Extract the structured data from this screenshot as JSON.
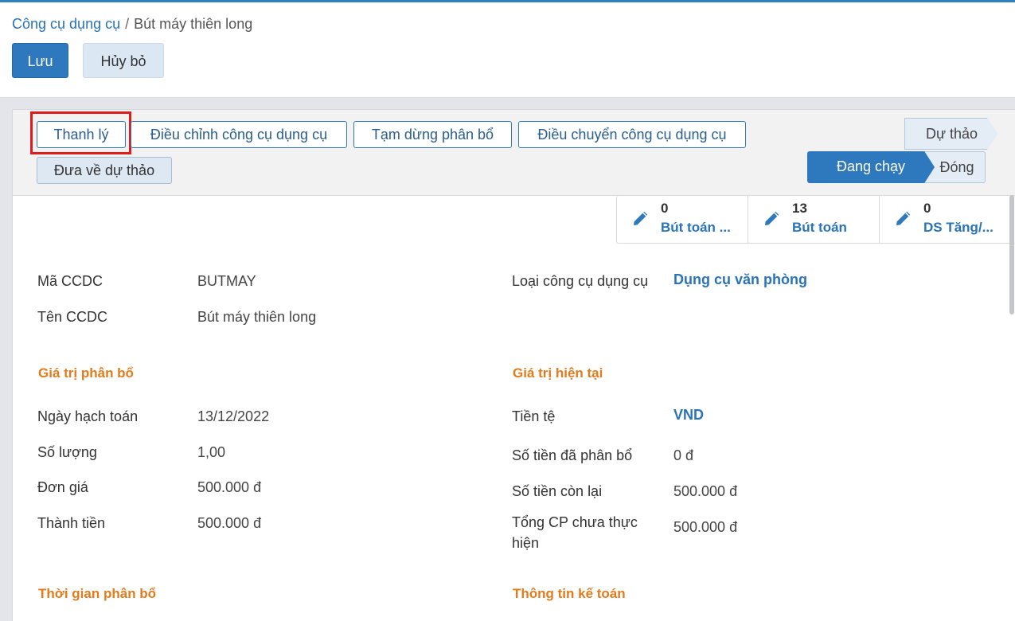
{
  "breadcrumb": {
    "parent": "Công cụ dụng cụ",
    "separator": "/",
    "current": "Bút máy thiên long"
  },
  "toolbar": {
    "save_label": "Lưu",
    "cancel_label": "Hủy bỏ"
  },
  "actions": {
    "liquidate": "Thanh lý",
    "adjust": "Điều chỉnh công cụ dụng cụ",
    "suspend": "Tạm dừng phân bổ",
    "transfer": "Điều chuyển công cụ dụng cụ",
    "to_draft": "Đưa về dự thảo"
  },
  "stages": {
    "draft": "Dự thảo",
    "running": "Đang chạy",
    "closed": "Đóng",
    "active": "Đang chạy"
  },
  "smart_buttons": [
    {
      "count": "0",
      "label": "Bút toán ..."
    },
    {
      "count": "13",
      "label": "Bút toán"
    },
    {
      "count": "0",
      "label": "DS Tăng/..."
    }
  ],
  "fields": {
    "code_label": "Mã CCDC",
    "code_value": "BUTMAY",
    "name_label": "Tên CCDC",
    "name_value": "Bút máy thiên long",
    "type_label": "Loại công cụ dụng cụ",
    "type_value": "Dụng cụ văn phòng"
  },
  "allocation": {
    "title": "Giá trị phân bổ",
    "date_label": "Ngày hạch toán",
    "date_value": "13/12/2022",
    "qty_label": "Số lượng",
    "qty_value": "1,00",
    "price_label": "Đơn giá",
    "price_value": "500.000 đ",
    "total_label": "Thành tiền",
    "total_value": "500.000 đ"
  },
  "current_value": {
    "title": "Giá trị hiện tại",
    "currency_label": "Tiền tệ",
    "currency_value": "VND",
    "allocated_label": "Số tiền đã phân bổ",
    "allocated_value": "0 đ",
    "remaining_label": "Số tiền còn lại",
    "remaining_value": "500.000 đ",
    "unrealized_label_1": "Tổng CP chưa thực",
    "unrealized_label_2": "hiện",
    "unrealized_value": "500.000 đ"
  },
  "sections": {
    "time": "Thời gian phân bổ",
    "accounting": "Thông tin kế toán"
  },
  "colors": {
    "primary": "#2e78bd",
    "link": "#2a73b8",
    "section": "#e37b1c",
    "highlight": "#e01b1b"
  }
}
